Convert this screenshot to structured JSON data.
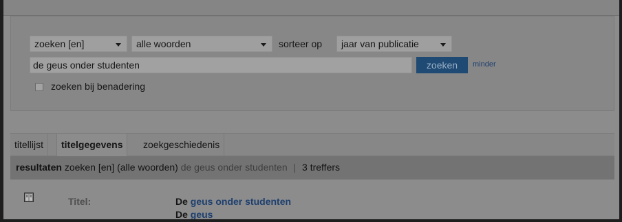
{
  "search": {
    "scope_select": "zoeken [en]",
    "words_select": "alle woorden",
    "sort_label": "sorteer op",
    "sort_select": "jaar van publicatie",
    "query_value": "de geus onder studenten",
    "search_button": "zoeken",
    "less_link": "minder",
    "fuzzy_label": "zoeken bij benadering",
    "fuzzy_checked": false
  },
  "tabs": [
    {
      "label": "titellijst",
      "active": false
    },
    {
      "label": "titelgegevens",
      "active": true
    },
    {
      "label": "zoekgeschiedenis",
      "active": false
    }
  ],
  "results": {
    "label": "resultaten",
    "scope_text": "zoeken [en]",
    "words_text": "(alle woorden)",
    "query_text": "de geus onder studenten",
    "separator": "|",
    "count_text": "3 treffers"
  },
  "record": {
    "icon": "book-icon",
    "field_label": "Titel:",
    "lines": [
      {
        "prefix": "De",
        "highlight": "geus onder studenten"
      },
      {
        "prefix": "De",
        "highlight": "geus"
      }
    ]
  },
  "colors": {
    "accent_button": "#1f4a74",
    "link": "#1d3f6e"
  }
}
